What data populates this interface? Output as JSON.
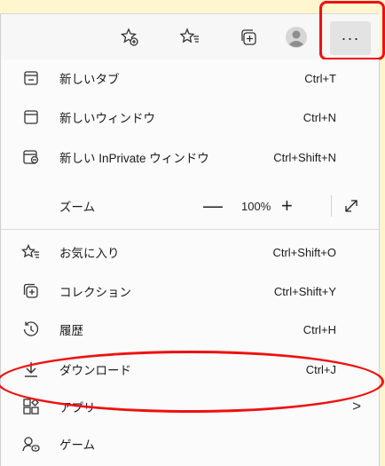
{
  "toolbar": {
    "icons": [
      "add-favorite-icon",
      "favorites-icon",
      "collections-icon",
      "profile-icon"
    ],
    "more_label": "···"
  },
  "menu": {
    "items": [
      {
        "icon": "new-tab-icon",
        "label": "新しいタブ",
        "shortcut": "Ctrl+T"
      },
      {
        "icon": "new-window-icon",
        "label": "新しいウィンドウ",
        "shortcut": "Ctrl+N"
      },
      {
        "icon": "inprivate-window-icon",
        "label": "新しい InPrivate ウィンドウ",
        "shortcut": "Ctrl+Shift+N"
      },
      {
        "icon": "",
        "label": "ズーム",
        "shortcut": ""
      },
      {
        "icon": "favorites-icon",
        "label": "お気に入り",
        "shortcut": "Ctrl+Shift+O"
      },
      {
        "icon": "collections-icon",
        "label": "コレクション",
        "shortcut": "Ctrl+Shift+Y"
      },
      {
        "icon": "history-icon",
        "label": "履歴",
        "shortcut": "Ctrl+H"
      },
      {
        "icon": "download-icon",
        "label": "ダウンロード",
        "shortcut": "Ctrl+J"
      },
      {
        "icon": "apps-icon",
        "label": "アプリ",
        "shortcut": ">"
      },
      {
        "icon": "games-icon",
        "label": "ゲーム",
        "shortcut": ""
      }
    ],
    "zoom": {
      "minus": "—",
      "value": "100%",
      "plus": "+"
    }
  },
  "colors": {
    "annotation": "#ee1111",
    "menu_bg": "#fbfbfb",
    "page_bg": "#fff6cf"
  }
}
